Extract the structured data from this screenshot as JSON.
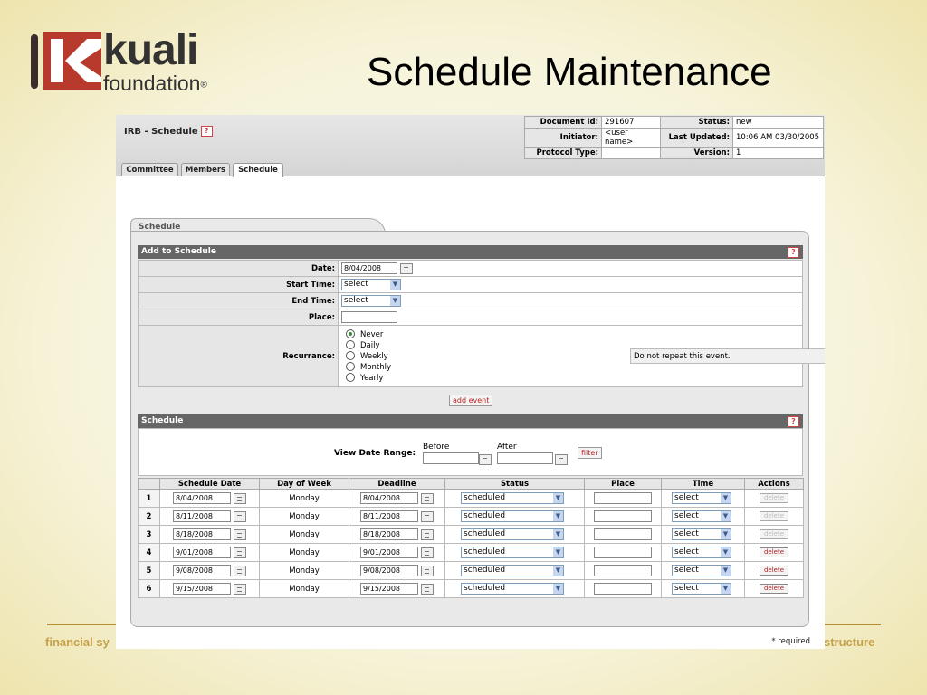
{
  "slide": {
    "title": "Schedule Maintenance",
    "logo": {
      "word": "kuali",
      "sub": "foundation",
      "reg": "®"
    },
    "footer_left": "financial sy",
    "footer_right": "structure"
  },
  "app": {
    "doc_title": "IRB - Schedule",
    "help_icon": "?",
    "doc_info": {
      "document_id_label": "Document Id:",
      "document_id": "291607",
      "status_label": "Status:",
      "status": "new",
      "initiator_label": "Initiator:",
      "initiator": "<user name>",
      "last_updated_label": "Last Updated:",
      "last_updated": "10:06 AM 03/30/2005",
      "protocol_type_label": "Protocol Type:",
      "protocol_type": "",
      "version_label": "Version:",
      "version": "1"
    },
    "tabs": [
      "Committee",
      "Members",
      "Schedule"
    ],
    "active_tab": "Schedule"
  },
  "schedule_tab_title": "Schedule",
  "add_section": {
    "title": "Add to Schedule",
    "date_label": "Date:",
    "date_value": "8/04/2008",
    "start_time_label": "Start Time:",
    "start_time_value": "select",
    "end_time_label": "End Time:",
    "end_time_value": "select",
    "place_label": "Place:",
    "place_value": "",
    "recurrence_label": "Recurrance:",
    "recurrence_options": [
      "Never",
      "Daily",
      "Weekly",
      "Monthly",
      "Yearly"
    ],
    "recurrence_selected": "Never",
    "repeat_text": "Do not repeat this event.",
    "add_button": "add event"
  },
  "schedule_section": {
    "title": "Schedule",
    "view_range_label": "View Date Range:",
    "before_label": "Before",
    "after_label": "After",
    "before_value": "",
    "after_value": "",
    "filter_button": "filter",
    "columns": [
      "Schedule Date",
      "Day of Week",
      "Deadline",
      "Status",
      "Place",
      "Time",
      "Actions"
    ],
    "rows": [
      {
        "n": "1",
        "date": "8/04/2008",
        "day": "Monday",
        "deadline": "8/04/2008",
        "status": "scheduled",
        "place": "",
        "time": "select",
        "action": "delete",
        "enabled": false
      },
      {
        "n": "2",
        "date": "8/11/2008",
        "day": "Monday",
        "deadline": "8/11/2008",
        "status": "scheduled",
        "place": "",
        "time": "select",
        "action": "delete",
        "enabled": false
      },
      {
        "n": "3",
        "date": "8/18/2008",
        "day": "Monday",
        "deadline": "8/18/2008",
        "status": "scheduled",
        "place": "",
        "time": "select",
        "action": "delete",
        "enabled": false
      },
      {
        "n": "4",
        "date": "9/01/2008",
        "day": "Monday",
        "deadline": "9/01/2008",
        "status": "scheduled",
        "place": "",
        "time": "select",
        "action": "delete",
        "enabled": true
      },
      {
        "n": "5",
        "date": "9/08/2008",
        "day": "Monday",
        "deadline": "9/08/2008",
        "status": "scheduled",
        "place": "",
        "time": "select",
        "action": "delete",
        "enabled": true
      },
      {
        "n": "6",
        "date": "9/15/2008",
        "day": "Monday",
        "deadline": "9/15/2008",
        "status": "scheduled",
        "place": "",
        "time": "select",
        "action": "delete",
        "enabled": true
      }
    ]
  },
  "required_note": "* required",
  "colors": {
    "brand_red": "#c0392b",
    "gold_line": "#b4902e",
    "header_bar": "#666666"
  }
}
